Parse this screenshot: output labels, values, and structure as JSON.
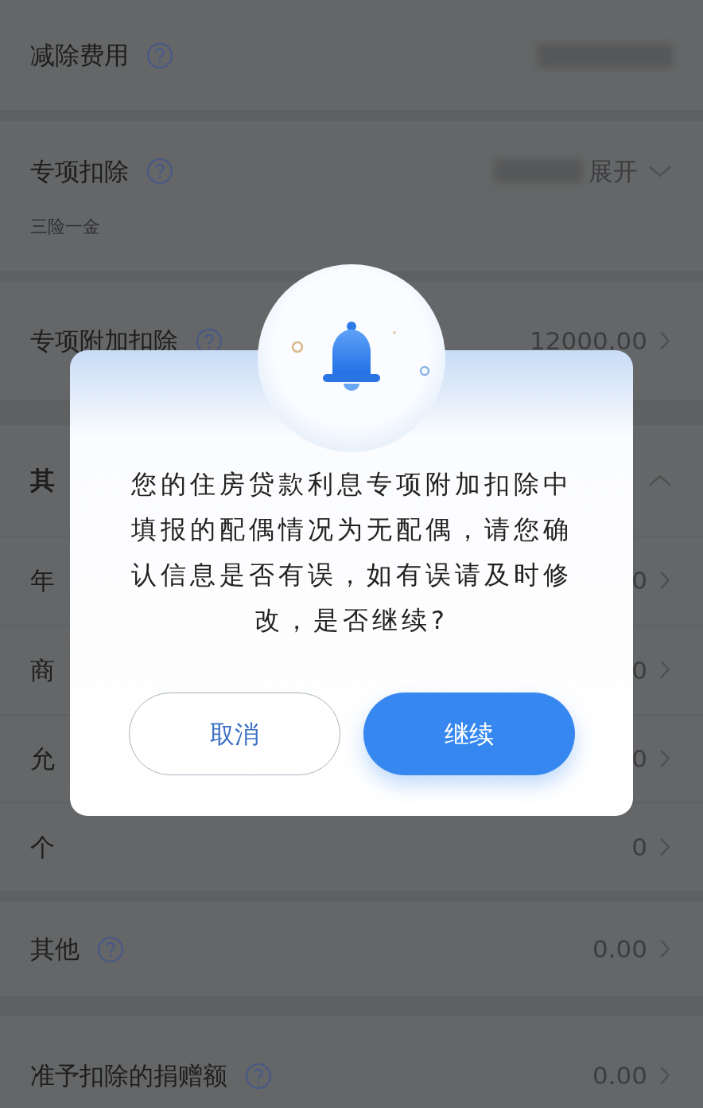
{
  "rows": [
    {
      "kind": "item",
      "label": "减除费用",
      "help": true,
      "redacted": true
    },
    {
      "kind": "item",
      "label": "专项扣除",
      "help": true,
      "redacted": true,
      "value": "展开",
      "expanded": false,
      "note": "三险一金"
    },
    {
      "kind": "item",
      "label": "专项附加扣除",
      "help": true,
      "value": "12000.00",
      "link": true
    },
    {
      "kind": "header",
      "label": "其",
      "expanded": true
    },
    {
      "kind": "item",
      "label": "年",
      "value": "0",
      "link": true
    },
    {
      "kind": "item",
      "label": "商",
      "value": "0",
      "link": true
    },
    {
      "kind": "item",
      "label": "允",
      "value": "0",
      "link": true
    },
    {
      "kind": "item",
      "label": "个",
      "value": "0",
      "link": true
    },
    {
      "kind": "item",
      "label": "其他",
      "help": true,
      "value": "0.00",
      "link": true
    },
    {
      "kind": "item",
      "label": "准予扣除的捐赠额",
      "help": true,
      "value": "0.00",
      "link": true
    }
  ],
  "dialog": {
    "message": "您的住房贷款利息专项附加扣除中填报的配偶情况为无配偶，请您确认信息是否有误，如有误请及时修改，是否继续?",
    "buttons": [
      {
        "label": "取消",
        "kind": "secondary"
      },
      {
        "label": "继续",
        "kind": "primary"
      }
    ]
  }
}
